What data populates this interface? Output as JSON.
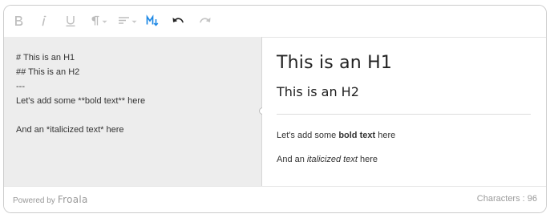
{
  "toolbar": {
    "buttons": [
      {
        "name": "bold-icon",
        "state": "disabled"
      },
      {
        "name": "italic-icon",
        "state": "disabled"
      },
      {
        "name": "underline-icon",
        "state": "disabled"
      },
      {
        "name": "paragraph-format-icon",
        "state": "disabled"
      },
      {
        "name": "align-icon",
        "state": "disabled"
      },
      {
        "name": "markdown-icon",
        "state": "active"
      },
      {
        "name": "undo-icon",
        "state": "enabled"
      },
      {
        "name": "redo-icon",
        "state": "disabled"
      }
    ]
  },
  "source": {
    "lines": [
      "# This is an H1",
      "## This is an H2",
      "---",
      "Let's add some **bold text** here",
      "",
      "And an *italicized text* here"
    ]
  },
  "preview": {
    "h1": "This is an H1",
    "h2": "This is an H2",
    "p1_before": "Let's add some ",
    "p1_bold": "bold text",
    "p1_after": " here",
    "p2_before": "And an ",
    "p2_italic": "italicized text",
    "p2_after": " here"
  },
  "footer": {
    "powered_by": "Powered by",
    "brand": "Froala",
    "characters": "Characters : 96"
  },
  "colors": {
    "active_icon": "#1e88e5",
    "disabled_icon": "#bdbdbd",
    "enabled_icon": "#333333",
    "source_bg": "#ededed"
  }
}
